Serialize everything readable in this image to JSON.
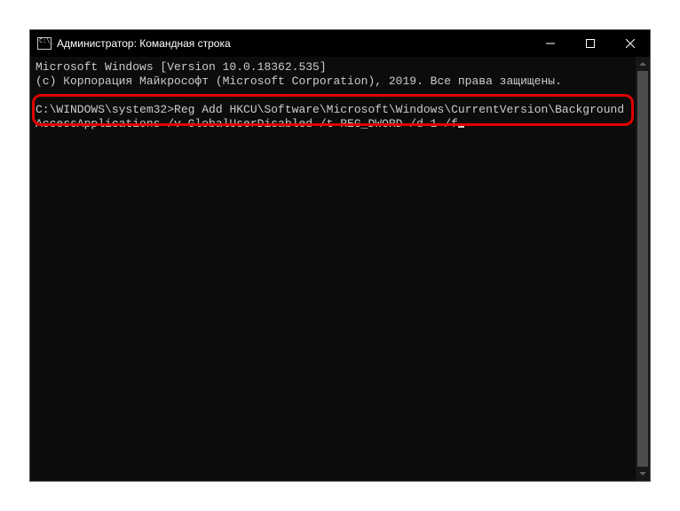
{
  "titlebar": {
    "title": "Администратор: Командная строка"
  },
  "terminal": {
    "line1": "Microsoft Windows [Version 10.0.18362.535]",
    "line2": "(c) Корпорация Майкрософт (Microsoft Corporation), 2019. Все права защищены.",
    "prompt": "C:\\WINDOWS\\system32>",
    "command": "Reg Add HKCU\\Software\\Microsoft\\Windows\\CurrentVersion\\BackgroundAccessApplications /v GlobalUserDisabled /t REG_DWORD /d 1 /f"
  }
}
